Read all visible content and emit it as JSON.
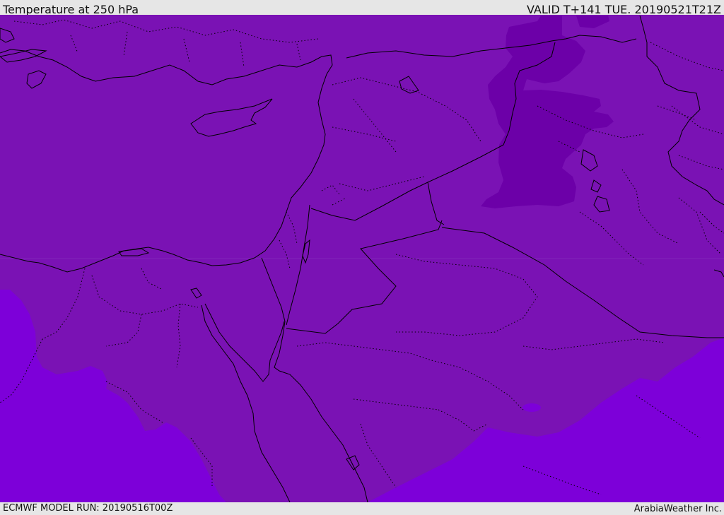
{
  "header": {
    "title": "Temperature at 250 hPa",
    "valid_time": "VALID T+141 TUE. 20190521T21Z"
  },
  "footer": {
    "model_run": "ECMWF MODEL RUN: 20190516T00Z",
    "credit": "ArabiaWeather Inc."
  },
  "map": {
    "colors": {
      "base_fill": "#7a12b4",
      "warm_fill": "#7d00d9",
      "cold_fill": "#6c00a8",
      "line": "#000000"
    }
  }
}
